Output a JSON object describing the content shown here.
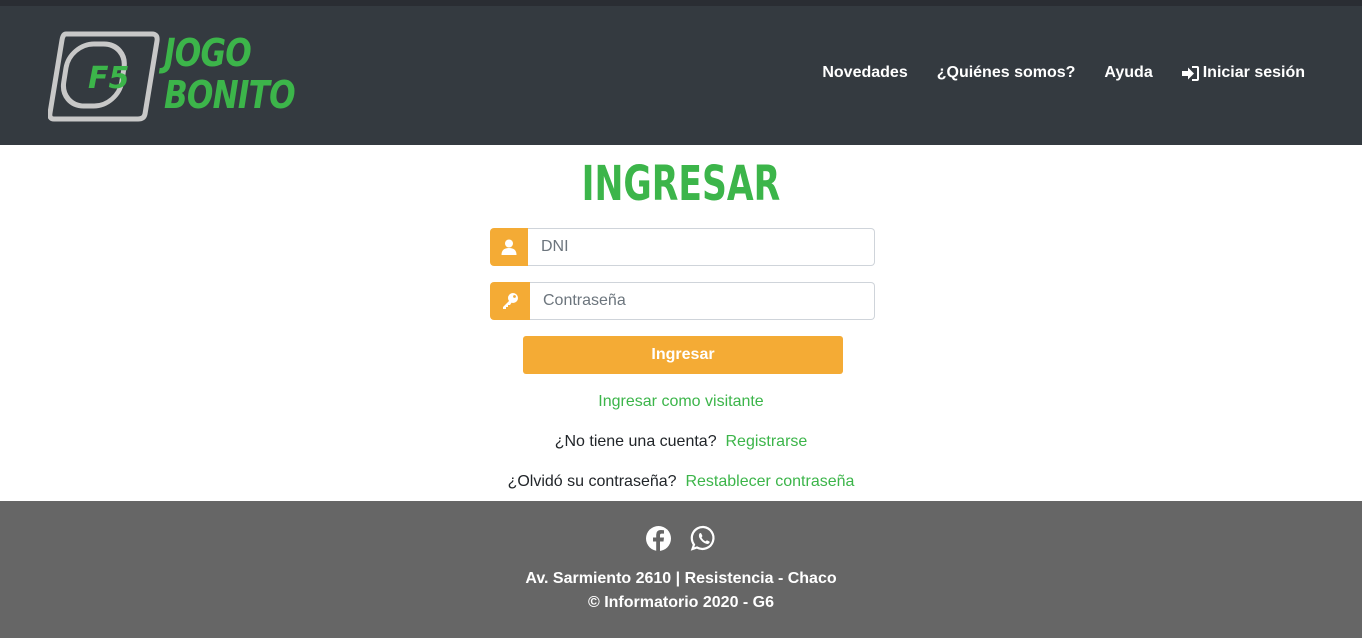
{
  "header": {
    "logo_text_line1": "JOGO",
    "logo_text_line2": "BONITO",
    "logo_badge": "F5",
    "nav": [
      {
        "label": "Novedades"
      },
      {
        "label": "¿Quiénes somos?"
      },
      {
        "label": "Ayuda"
      },
      {
        "label": "Iniciar sesión",
        "icon": "sign-in-icon"
      }
    ]
  },
  "login": {
    "title": "INGRESAR",
    "dni_placeholder": "DNI",
    "password_placeholder": "Contraseña",
    "submit_label": "Ingresar",
    "guest_link": "Ingresar como visitante",
    "no_account_text": "¿No tiene una cuenta?",
    "register_link": "Registrarse",
    "forgot_text": "¿Olvidó su contraseña?",
    "reset_link": "Restablecer contraseña"
  },
  "footer": {
    "address": "Av. Sarmiento 2610 | Resistencia - Chaco",
    "copyright": "© Informatorio 2020 - G6",
    "social": [
      "facebook-icon",
      "whatsapp-icon"
    ]
  },
  "colors": {
    "brand_green": "#3cb54a",
    "accent_orange": "#f4ab35",
    "header_bg": "#343a40",
    "footer_bg": "#666666"
  }
}
